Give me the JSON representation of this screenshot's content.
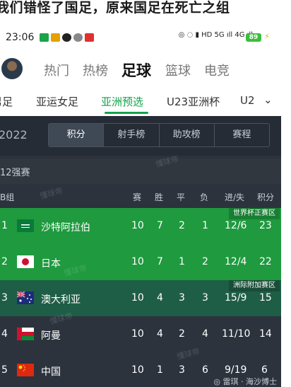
{
  "headline": "我们错怪了国足，原来国足在死亡之组",
  "status_bar": {
    "time": "23:06",
    "right_text": "◎ ◌ ▮ HD 5G ıll 4G ıll",
    "battery": "89",
    "icon_colors": [
      "#1aa34a",
      "#e6a100",
      "#222222",
      "#888888",
      "#e03030"
    ]
  },
  "top_nav": {
    "tabs": [
      "热门",
      "热榜",
      "足球",
      "篮球",
      "电竞"
    ],
    "active": "足球"
  },
  "sub_tabs": {
    "items": [
      "男足",
      "亚运女足",
      "亚洲预选",
      "U23亚洲杯",
      "U2"
    ],
    "active": "亚洲预选"
  },
  "season": "2022",
  "segments": [
    "积分",
    "射手榜",
    "助攻榜",
    "赛程"
  ],
  "stage_label": "12强赛",
  "table": {
    "group": "B组",
    "headers": [
      "赛",
      "胜",
      "平",
      "负",
      "进/失",
      "积分"
    ],
    "zone_labels": {
      "world_cup": "世界杯正赛区",
      "playoff": "洲际附加赛区"
    },
    "rows": [
      {
        "rank": "1",
        "team": "沙特阿拉伯",
        "flag": "saudi-arabia-flag",
        "played": "10",
        "won": "7",
        "drawn": "2",
        "lost": "1",
        "gf_ga": "12/6",
        "points": "23"
      },
      {
        "rank": "2",
        "team": "日本",
        "flag": "japan-flag",
        "played": "10",
        "won": "7",
        "drawn": "1",
        "lost": "2",
        "gf_ga": "12/4",
        "points": "22"
      },
      {
        "rank": "3",
        "team": "澳大利亚",
        "flag": "australia-flag",
        "played": "10",
        "won": "4",
        "drawn": "3",
        "lost": "3",
        "gf_ga": "15/9",
        "points": "15"
      },
      {
        "rank": "4",
        "team": "阿曼",
        "flag": "oman-flag",
        "played": "10",
        "won": "4",
        "drawn": "2",
        "lost": "4",
        "gf_ga": "11/10",
        "points": "14"
      },
      {
        "rank": "5",
        "team": "中国",
        "flag": "china-flag",
        "played": "10",
        "won": "1",
        "drawn": "3",
        "lost": "6",
        "gf_ga": "9/19",
        "points": "6"
      }
    ]
  },
  "watermark": "懂球帝",
  "footer_tag": "◎ 雷琪 · 海沙博士",
  "colors": {
    "accent": "#12a34a",
    "row_world_cup": "#1f9a3f",
    "row_playoff": "#1f5e46",
    "row_default": "#2c333d",
    "panel": "#2c333d"
  }
}
